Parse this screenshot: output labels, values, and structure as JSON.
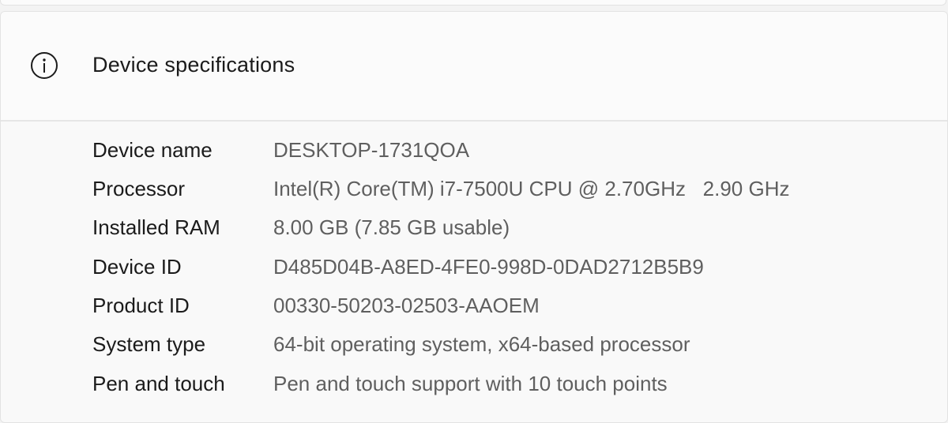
{
  "section": {
    "title": "Device specifications",
    "icon": "info-icon"
  },
  "specs": [
    {
      "label": "Device name",
      "value": "DESKTOP-1731QOA"
    },
    {
      "label": "Processor",
      "value": "Intel(R) Core(TM) i7-7500U CPU @ 2.70GHz   2.90 GHz"
    },
    {
      "label": "Installed RAM",
      "value": "8.00 GB (7.85 GB usable)"
    },
    {
      "label": "Device ID",
      "value": "D485D04B-A8ED-4FE0-998D-0DAD2712B5B9"
    },
    {
      "label": "Product ID",
      "value": "00330-50203-02503-AAOEM"
    },
    {
      "label": "System type",
      "value": "64-bit operating system, x64-based processor"
    },
    {
      "label": "Pen and touch",
      "value": "Pen and touch support with 10 touch points"
    }
  ]
}
